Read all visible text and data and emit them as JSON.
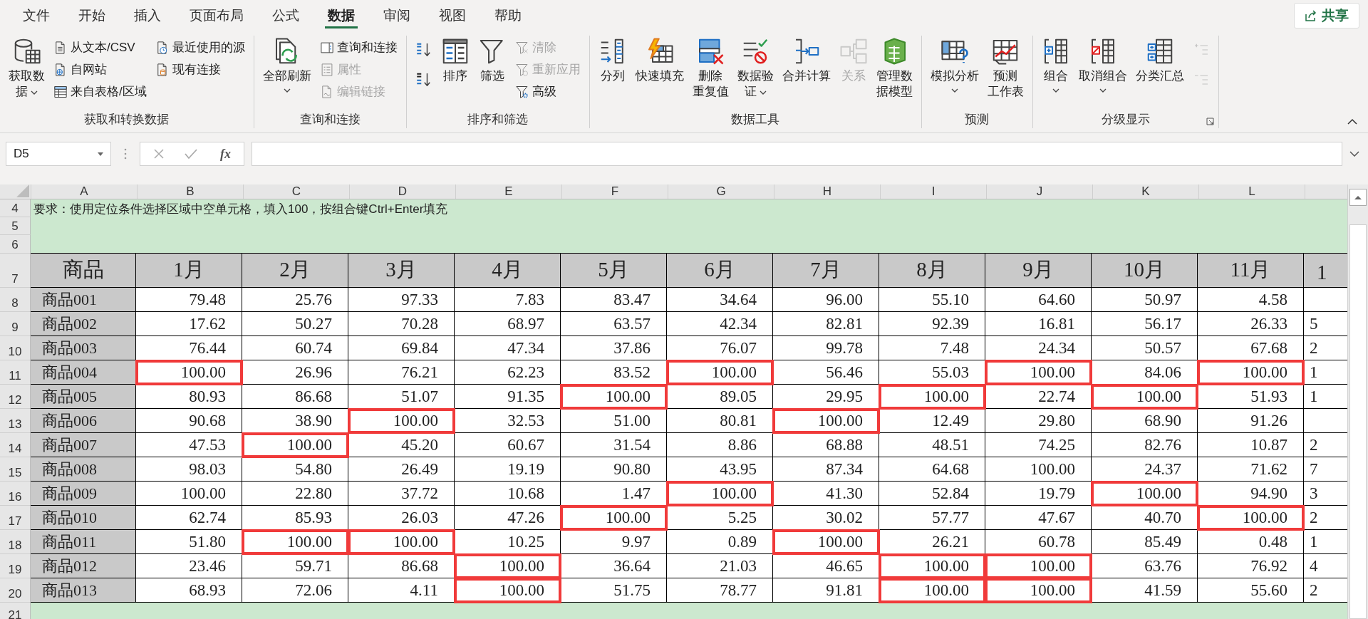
{
  "ribbon_tabs": [
    {
      "label": "文件",
      "selected": false
    },
    {
      "label": "开始",
      "selected": false
    },
    {
      "label": "插入",
      "selected": false
    },
    {
      "label": "页面布局",
      "selected": false
    },
    {
      "label": "公式",
      "selected": false
    },
    {
      "label": "数据",
      "selected": true
    },
    {
      "label": "审阅",
      "selected": false
    },
    {
      "label": "视图",
      "selected": false
    },
    {
      "label": "帮助",
      "selected": false
    }
  ],
  "share_button": "共享",
  "ribbon_groups": [
    {
      "label": "获取和转换数据",
      "launcher": false,
      "columns": [
        [
          {
            "kind": "large",
            "label": "获取数据",
            "dropdown": true,
            "disabled": false
          }
        ],
        [
          {
            "kind": "small",
            "label": "从文本/CSV",
            "disabled": false
          },
          {
            "kind": "small",
            "label": "自网站",
            "disabled": false
          },
          {
            "kind": "small",
            "label": "来自表格/区域",
            "disabled": false
          }
        ],
        [
          {
            "kind": "small",
            "label": "最近使用的源",
            "disabled": false
          },
          {
            "kind": "small",
            "label": "现有连接",
            "disabled": false
          }
        ]
      ]
    },
    {
      "label": "查询和连接",
      "launcher": false,
      "columns": [
        [
          {
            "kind": "large",
            "label": "全部刷新",
            "dropdown": true,
            "disabled": false
          }
        ],
        [
          {
            "kind": "small",
            "label": "查询和连接",
            "disabled": false
          },
          {
            "kind": "small",
            "label": "属性",
            "disabled": true
          },
          {
            "kind": "small",
            "label": "编辑链接",
            "disabled": true
          }
        ]
      ]
    },
    {
      "label": "排序和筛选",
      "launcher": false,
      "columns": [
        [
          {
            "kind": "icon",
            "disabled": false
          },
          {
            "kind": "icon",
            "disabled": false
          }
        ],
        [
          {
            "kind": "large",
            "label": "排序",
            "dropdown": false,
            "disabled": false
          }
        ],
        [
          {
            "kind": "large",
            "label": "筛选",
            "dropdown": false,
            "disabled": false
          }
        ],
        [
          {
            "kind": "small",
            "label": "清除",
            "disabled": true
          },
          {
            "kind": "small",
            "label": "重新应用",
            "disabled": true
          },
          {
            "kind": "small",
            "label": "高级",
            "disabled": false
          }
        ]
      ]
    },
    {
      "label": "数据工具",
      "launcher": false,
      "columns": [
        [
          {
            "kind": "large",
            "label": "分列",
            "dropdown": false,
            "disabled": false
          }
        ],
        [
          {
            "kind": "large",
            "label": "快速填充",
            "dropdown": false,
            "disabled": false
          }
        ],
        [
          {
            "kind": "large",
            "label": "删除重复值",
            "dropdown": false,
            "disabled": false
          }
        ],
        [
          {
            "kind": "large",
            "label": "数据验证",
            "dropdown": true,
            "disabled": false
          }
        ],
        [
          {
            "kind": "large",
            "label": "合并计算",
            "dropdown": false,
            "disabled": false
          }
        ],
        [
          {
            "kind": "large",
            "label": "关系",
            "dropdown": false,
            "disabled": true
          }
        ],
        [
          {
            "kind": "large",
            "label": "管理数据模型",
            "dropdown": false,
            "disabled": false
          }
        ]
      ]
    },
    {
      "label": "预测",
      "launcher": false,
      "columns": [
        [
          {
            "kind": "large",
            "label": "模拟分析",
            "dropdown": true,
            "disabled": false
          }
        ],
        [
          {
            "kind": "large",
            "label": "预测工作表",
            "dropdown": false,
            "disabled": false
          }
        ]
      ]
    },
    {
      "label": "分级显示",
      "launcher": true,
      "columns": [
        [
          {
            "kind": "large",
            "label": "组合",
            "dropdown": true,
            "disabled": false
          }
        ],
        [
          {
            "kind": "large",
            "label": "取消组合",
            "dropdown": true,
            "disabled": false
          }
        ],
        [
          {
            "kind": "large",
            "label": "分类汇总",
            "dropdown": false,
            "disabled": false
          }
        ],
        [
          {
            "kind": "icon",
            "disabled": true
          },
          {
            "kind": "icon",
            "disabled": true
          }
        ]
      ]
    }
  ],
  "formula_bar": {
    "name_box": "D5",
    "function_button": "fx"
  },
  "sheet": {
    "columns": [
      "A",
      "B",
      "C",
      "D",
      "E",
      "F",
      "G",
      "H",
      "I",
      "J",
      "K",
      "L"
    ],
    "top_rows": [
      "4",
      "5",
      "6"
    ],
    "note": "要求：使用定位条件选择区域中空单元格，填入100，按组合键Ctrl+Enter填充",
    "header_row": {
      "number": "7",
      "cells": [
        "商品",
        "1月",
        "2月",
        "3月",
        "4月",
        "5月",
        "6月",
        "7月",
        "8月",
        "9月",
        "10月",
        "11月",
        "1"
      ]
    },
    "rows": [
      {
        "number": "8",
        "product": "商品001",
        "values": [
          {
            "text": "79.48",
            "boxed": false
          },
          {
            "text": "25.76",
            "boxed": false
          },
          {
            "text": "97.33",
            "boxed": false
          },
          {
            "text": "7.83",
            "boxed": false
          },
          {
            "text": "83.47",
            "boxed": false
          },
          {
            "text": "34.64",
            "boxed": false
          },
          {
            "text": "96.00",
            "boxed": false
          },
          {
            "text": "55.10",
            "boxed": false
          },
          {
            "text": "64.60",
            "boxed": false
          },
          {
            "text": "50.97",
            "boxed": false
          },
          {
            "text": "4.58",
            "boxed": false
          }
        ]
      },
      {
        "number": "9",
        "product": "商品002",
        "values": [
          {
            "text": "17.62",
            "boxed": false
          },
          {
            "text": "50.27",
            "boxed": false
          },
          {
            "text": "70.28",
            "boxed": false
          },
          {
            "text": "68.97",
            "boxed": false
          },
          {
            "text": "63.57",
            "boxed": false
          },
          {
            "text": "42.34",
            "boxed": false
          },
          {
            "text": "82.81",
            "boxed": false
          },
          {
            "text": "92.39",
            "boxed": false
          },
          {
            "text": "16.81",
            "boxed": false
          },
          {
            "text": "56.17",
            "boxed": false
          },
          {
            "text": "26.33",
            "boxed": false
          }
        ],
        "cut": "5"
      },
      {
        "number": "10",
        "product": "商品003",
        "values": [
          {
            "text": "76.44",
            "boxed": false
          },
          {
            "text": "60.74",
            "boxed": false
          },
          {
            "text": "69.84",
            "boxed": false
          },
          {
            "text": "47.34",
            "boxed": false
          },
          {
            "text": "37.86",
            "boxed": false
          },
          {
            "text": "76.07",
            "boxed": false
          },
          {
            "text": "99.78",
            "boxed": false
          },
          {
            "text": "7.48",
            "boxed": false
          },
          {
            "text": "24.34",
            "boxed": false
          },
          {
            "text": "50.57",
            "boxed": false
          },
          {
            "text": "67.68",
            "boxed": false
          }
        ],
        "cut": "2"
      },
      {
        "number": "11",
        "product": "商品004",
        "values": [
          {
            "text": "100.00",
            "boxed": true
          },
          {
            "text": "26.96",
            "boxed": false
          },
          {
            "text": "76.21",
            "boxed": false
          },
          {
            "text": "62.23",
            "boxed": false
          },
          {
            "text": "83.52",
            "boxed": false
          },
          {
            "text": "100.00",
            "boxed": true
          },
          {
            "text": "56.46",
            "boxed": false
          },
          {
            "text": "55.03",
            "boxed": false
          },
          {
            "text": "100.00",
            "boxed": true
          },
          {
            "text": "84.06",
            "boxed": false
          },
          {
            "text": "100.00",
            "boxed": true
          }
        ],
        "cut": "1"
      },
      {
        "number": "12",
        "product": "商品005",
        "values": [
          {
            "text": "80.93",
            "boxed": false
          },
          {
            "text": "86.68",
            "boxed": false
          },
          {
            "text": "51.07",
            "boxed": false
          },
          {
            "text": "91.35",
            "boxed": false
          },
          {
            "text": "100.00",
            "boxed": true
          },
          {
            "text": "89.05",
            "boxed": false
          },
          {
            "text": "29.95",
            "boxed": false
          },
          {
            "text": "100.00",
            "boxed": true
          },
          {
            "text": "22.74",
            "boxed": false
          },
          {
            "text": "100.00",
            "boxed": true
          },
          {
            "text": "51.93",
            "boxed": false
          }
        ],
        "cut": "1"
      },
      {
        "number": "13",
        "product": "商品006",
        "values": [
          {
            "text": "90.68",
            "boxed": false
          },
          {
            "text": "38.90",
            "boxed": false
          },
          {
            "text": "100.00",
            "boxed": true
          },
          {
            "text": "32.53",
            "boxed": false
          },
          {
            "text": "51.00",
            "boxed": false
          },
          {
            "text": "80.81",
            "boxed": false
          },
          {
            "text": "100.00",
            "boxed": true
          },
          {
            "text": "12.49",
            "boxed": false
          },
          {
            "text": "29.80",
            "boxed": false
          },
          {
            "text": "68.90",
            "boxed": false
          },
          {
            "text": "91.26",
            "boxed": false
          }
        ]
      },
      {
        "number": "14",
        "product": "商品007",
        "values": [
          {
            "text": "47.53",
            "boxed": false
          },
          {
            "text": "100.00",
            "boxed": true
          },
          {
            "text": "45.20",
            "boxed": false
          },
          {
            "text": "60.67",
            "boxed": false
          },
          {
            "text": "31.54",
            "boxed": false
          },
          {
            "text": "8.86",
            "boxed": false
          },
          {
            "text": "68.88",
            "boxed": false
          },
          {
            "text": "48.51",
            "boxed": false
          },
          {
            "text": "74.25",
            "boxed": false
          },
          {
            "text": "82.76",
            "boxed": false
          },
          {
            "text": "10.87",
            "boxed": false
          }
        ],
        "cut": "2"
      },
      {
        "number": "15",
        "product": "商品008",
        "values": [
          {
            "text": "98.03",
            "boxed": false
          },
          {
            "text": "54.80",
            "boxed": false
          },
          {
            "text": "26.49",
            "boxed": false
          },
          {
            "text": "19.19",
            "boxed": false
          },
          {
            "text": "90.80",
            "boxed": false
          },
          {
            "text": "43.95",
            "boxed": false
          },
          {
            "text": "87.34",
            "boxed": false
          },
          {
            "text": "64.68",
            "boxed": false
          },
          {
            "text": "100.00",
            "boxed": false
          },
          {
            "text": "24.37",
            "boxed": false
          },
          {
            "text": "71.62",
            "boxed": false
          }
        ],
        "cut": "7"
      },
      {
        "number": "16",
        "product": "商品009",
        "values": [
          {
            "text": "100.00",
            "boxed": false
          },
          {
            "text": "22.80",
            "boxed": false
          },
          {
            "text": "37.72",
            "boxed": false
          },
          {
            "text": "10.68",
            "boxed": false
          },
          {
            "text": "1.47",
            "boxed": false
          },
          {
            "text": "100.00",
            "boxed": true
          },
          {
            "text": "41.30",
            "boxed": false
          },
          {
            "text": "52.84",
            "boxed": false
          },
          {
            "text": "19.79",
            "boxed": false
          },
          {
            "text": "100.00",
            "boxed": true
          },
          {
            "text": "94.90",
            "boxed": false
          }
        ],
        "cut": "3"
      },
      {
        "number": "17",
        "product": "商品010",
        "values": [
          {
            "text": "62.74",
            "boxed": false
          },
          {
            "text": "85.93",
            "boxed": false
          },
          {
            "text": "26.03",
            "boxed": false
          },
          {
            "text": "47.26",
            "boxed": false
          },
          {
            "text": "100.00",
            "boxed": true
          },
          {
            "text": "5.25",
            "boxed": false
          },
          {
            "text": "30.02",
            "boxed": false
          },
          {
            "text": "57.77",
            "boxed": false
          },
          {
            "text": "47.67",
            "boxed": false
          },
          {
            "text": "40.70",
            "boxed": false
          },
          {
            "text": "100.00",
            "boxed": true
          }
        ],
        "cut": "2"
      },
      {
        "number": "18",
        "product": "商品011",
        "values": [
          {
            "text": "51.80",
            "boxed": false
          },
          {
            "text": "100.00",
            "boxed": true
          },
          {
            "text": "100.00",
            "boxed": true
          },
          {
            "text": "10.25",
            "boxed": false
          },
          {
            "text": "9.97",
            "boxed": false
          },
          {
            "text": "0.89",
            "boxed": false
          },
          {
            "text": "100.00",
            "boxed": true
          },
          {
            "text": "26.21",
            "boxed": false
          },
          {
            "text": "60.78",
            "boxed": false
          },
          {
            "text": "85.49",
            "boxed": false
          },
          {
            "text": "0.48",
            "boxed": false
          }
        ],
        "cut": "1"
      },
      {
        "number": "19",
        "product": "商品012",
        "values": [
          {
            "text": "23.46",
            "boxed": false
          },
          {
            "text": "59.71",
            "boxed": false
          },
          {
            "text": "86.68",
            "boxed": false
          },
          {
            "text": "100.00",
            "boxed": true
          },
          {
            "text": "36.64",
            "boxed": false
          },
          {
            "text": "21.03",
            "boxed": false
          },
          {
            "text": "46.65",
            "boxed": false
          },
          {
            "text": "100.00",
            "boxed": true
          },
          {
            "text": "100.00",
            "boxed": true
          },
          {
            "text": "63.76",
            "boxed": false
          },
          {
            "text": "76.92",
            "boxed": false
          }
        ],
        "cut": "4"
      },
      {
        "number": "20",
        "product": "商品013",
        "values": [
          {
            "text": "68.93",
            "boxed": false
          },
          {
            "text": "72.06",
            "boxed": false
          },
          {
            "text": "4.11",
            "boxed": false
          },
          {
            "text": "100.00",
            "boxed": true
          },
          {
            "text": "51.75",
            "boxed": false
          },
          {
            "text": "78.77",
            "boxed": false
          },
          {
            "text": "91.81",
            "boxed": false
          },
          {
            "text": "100.00",
            "boxed": true
          },
          {
            "text": "100.00",
            "boxed": true
          },
          {
            "text": "41.59",
            "boxed": false
          },
          {
            "text": "55.60",
            "boxed": false
          }
        ],
        "cut": "2"
      }
    ],
    "bottom_row": "21"
  }
}
